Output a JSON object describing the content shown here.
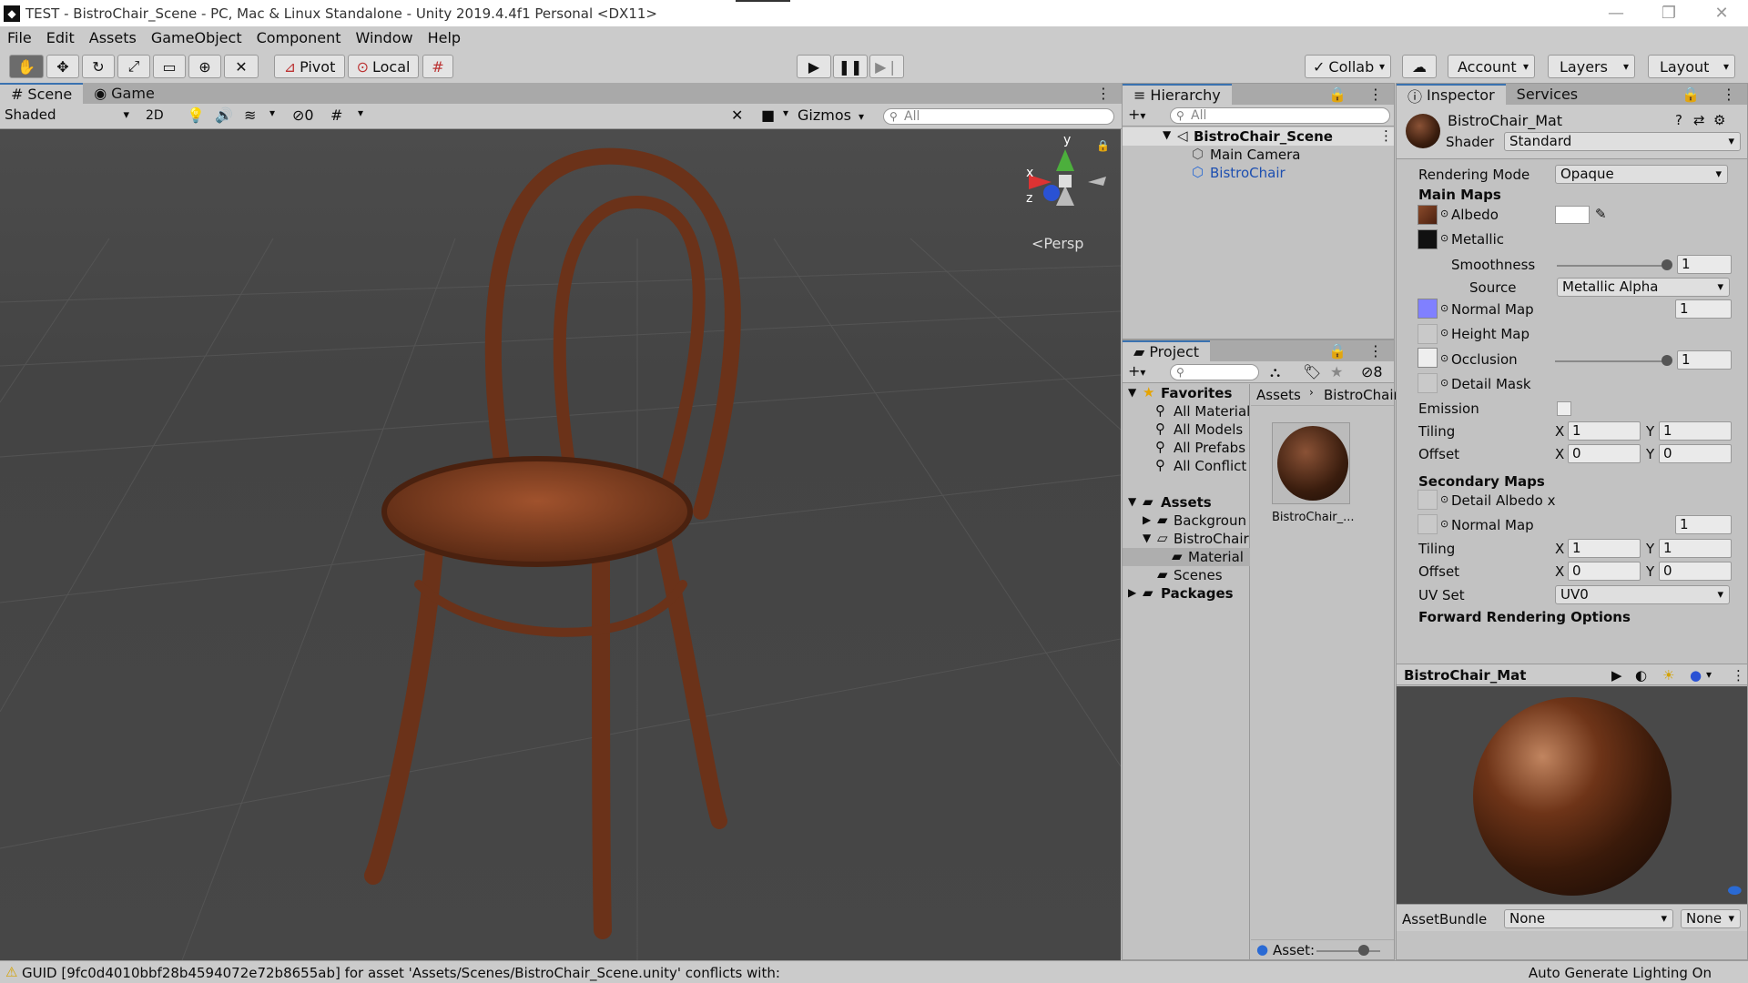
{
  "window": {
    "title": "TEST - BistroChair_Scene - PC, Mac & Linux Standalone - Unity 2019.4.4f1 Personal <DX11>",
    "controls": [
      "—",
      "❐",
      "✕"
    ]
  },
  "menu": [
    "File",
    "Edit",
    "Assets",
    "GameObject",
    "Component",
    "Window",
    "Help"
  ],
  "toolbar": {
    "pivot": "Pivot",
    "local": "Local",
    "collab": "Collab",
    "account": "Account",
    "layers": "Layers",
    "layout": "Layout"
  },
  "scene": {
    "tabs": [
      "Scene",
      "Game"
    ],
    "shading": "Shaded",
    "mode2d": "2D",
    "hidden_count": "0",
    "gizmos": "Gizmos",
    "search_placeholder": "All",
    "persp": "<Persp",
    "axes": {
      "x": "x",
      "y": "y",
      "z": "z"
    }
  },
  "hierarchy": {
    "tab": "Hierarchy",
    "search_placeholder": "All",
    "scene_name": "BistroChair_Scene",
    "items": [
      "Main Camera",
      "BistroChair"
    ]
  },
  "project": {
    "tab": "Project",
    "hidden_count": "8",
    "favorites": {
      "label": "Favorites",
      "items": [
        "All Material",
        "All Models",
        "All Prefabs",
        "All Conflict"
      ]
    },
    "assets": {
      "label": "Assets",
      "items": [
        "Backgroun",
        "BistroChair",
        "Material",
        "Scenes"
      ]
    },
    "packages": "Packages",
    "breadcrumb": [
      "Assets",
      "BistroChair"
    ],
    "asset_item": "BistroChair_...",
    "footer_label": "Asset:"
  },
  "inspector": {
    "tabs": [
      "Inspector",
      "Services"
    ],
    "material_name": "BistroChair_Mat",
    "shader_label": "Shader",
    "shader_value": "Standard",
    "rendering_mode_label": "Rendering Mode",
    "rendering_mode_value": "Opaque",
    "main_maps": "Main Maps",
    "albedo": "Albedo",
    "metallic": "Metallic",
    "smoothness_label": "Smoothness",
    "smoothness_value": "1",
    "source_label": "Source",
    "source_value": "Metallic Alpha",
    "normal_map": "Normal Map",
    "normal_value": "1",
    "height_map": "Height Map",
    "occlusion": "Occlusion",
    "occlusion_value": "1",
    "detail_mask": "Detail Mask",
    "emission": "Emission",
    "tiling": "Tiling",
    "offset": "Offset",
    "x": "X",
    "y": "Y",
    "tiling_x": "1",
    "tiling_y": "1",
    "offset_x": "0",
    "offset_y": "0",
    "secondary_maps": "Secondary Maps",
    "detail_albedo": "Detail Albedo x",
    "normal_map2": "Normal Map",
    "normal2_value": "1",
    "tiling2_x": "1",
    "tiling2_y": "1",
    "offset2_x": "0",
    "offset2_y": "0",
    "uv_set_label": "UV Set",
    "uv_set_value": "UV0",
    "forward_options": "Forward Rendering Options",
    "preview_title": "BistroChair_Mat",
    "assetbundle_label": "AssetBundle",
    "assetbundle_value": "None",
    "assetbundle_variant": "None"
  },
  "status": {
    "message": "GUID [9fc0d4010bbf28b4594072e72b8655ab] for asset 'Assets/Scenes/BistroChair_Scene.unity' conflicts with:",
    "right": "Auto Generate Lighting On"
  }
}
